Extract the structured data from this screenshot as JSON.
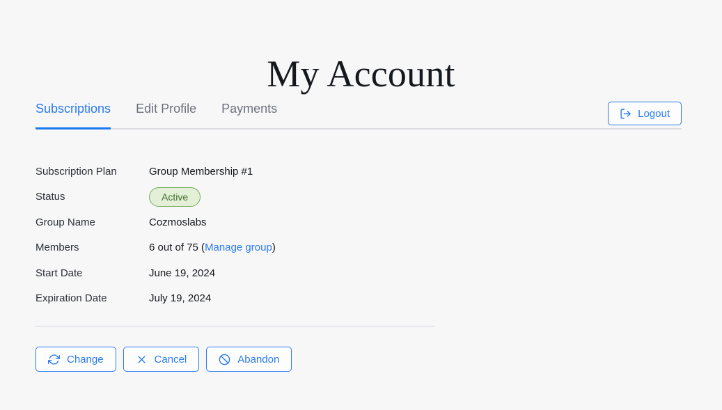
{
  "page": {
    "title": "My Account",
    "background_color": "#f7f7f8",
    "accent_color": "#2a7bf0"
  },
  "tabs": [
    {
      "label": "Subscriptions",
      "active": true
    },
    {
      "label": "Edit Profile",
      "active": false
    },
    {
      "label": "Payments",
      "active": false
    }
  ],
  "logout": {
    "label": "Logout",
    "icon": "logout-icon"
  },
  "details": {
    "rows": [
      {
        "label": "Subscription Plan",
        "value": "Group Membership #1"
      },
      {
        "label": "Status",
        "value": "Active"
      },
      {
        "label": "Group Name",
        "value": "Cozmoslabs"
      },
      {
        "label": "Members",
        "value": "6 out of 75 (",
        "link": "Manage group",
        "value_suffix": ")"
      },
      {
        "label": "Start Date",
        "value": "June 19, 2024"
      },
      {
        "label": "Expiration Date",
        "value": "July 19, 2024"
      }
    ]
  },
  "status_badge": {
    "text": "Active",
    "background_color": "#e3f0d7",
    "border_color": "#76ab5c",
    "text_color": "#3e6b2a"
  },
  "actions": [
    {
      "label": "Change",
      "icon": "refresh-icon"
    },
    {
      "label": "Cancel",
      "icon": "close-icon"
    },
    {
      "label": "Abandon",
      "icon": "ban-icon"
    }
  ]
}
